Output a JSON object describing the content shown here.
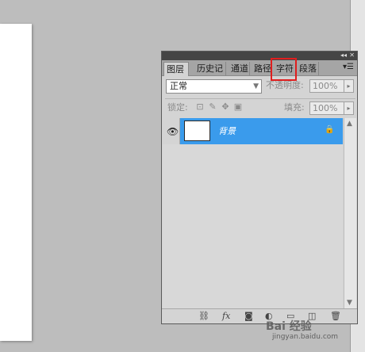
{
  "panel": {
    "collapse_glyph": "◂◂",
    "close_glyph": "✕",
    "menu_glyph": "▾☰",
    "tabs": [
      {
        "label": "图层",
        "active": true
      },
      {
        "label": "历史记"
      },
      {
        "label": "通道"
      },
      {
        "label": "路径"
      },
      {
        "label": "字符"
      },
      {
        "label": "段落"
      }
    ]
  },
  "blend": {
    "mode": "正常",
    "opacity_label": "不透明度:",
    "opacity_value": "100%"
  },
  "lock": {
    "label": "锁定:",
    "fill_label": "填充:",
    "fill_value": "100%",
    "icons": [
      "transparent-pixels-lock-icon",
      "brush-icon",
      "move-icon",
      "lock-all-icon"
    ]
  },
  "layers": [
    {
      "name": "背景",
      "visible": true,
      "locked": true,
      "selected": true
    }
  ],
  "bottom_icons": [
    "link-icon",
    "fx-icon",
    "mask-icon",
    "adjustment-icon",
    "folder-icon",
    "new-layer-icon",
    "trash-icon"
  ],
  "watermark": {
    "brand": "Bai 经验",
    "url": "jingyan.baidu.com"
  },
  "colors": {
    "selection": "#3a9bec",
    "highlight_box": "#e01e1e"
  }
}
